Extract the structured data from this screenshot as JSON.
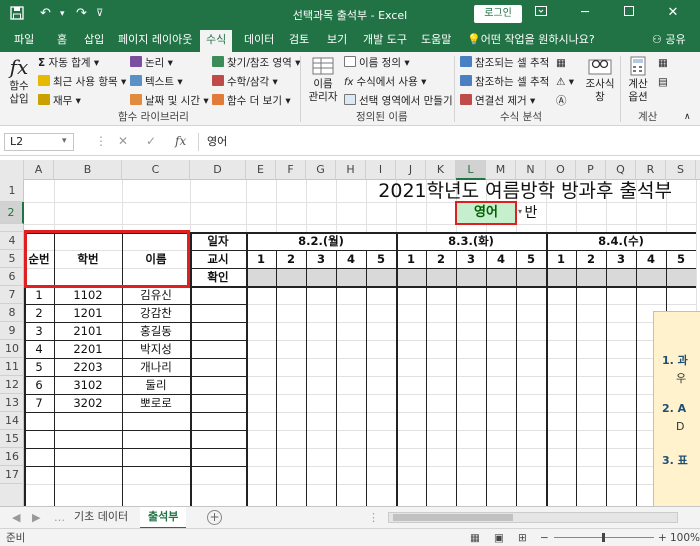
{
  "window": {
    "title": "선택과목 출석부 - Excel",
    "login_label": "로그인"
  },
  "tabs": [
    {
      "label": "파일"
    },
    {
      "label": "홈"
    },
    {
      "label": "삽입"
    },
    {
      "label": "페이지 레이아웃"
    },
    {
      "label": "수식"
    },
    {
      "label": "데이터"
    },
    {
      "label": "검토"
    },
    {
      "label": "보기"
    },
    {
      "label": "개발 도구"
    },
    {
      "label": "도움말"
    }
  ],
  "tell_me": "어떤 작업을 원하시나요?",
  "share": "공유",
  "ribbon": {
    "insert_function": "함수\n삽입",
    "fx_glyph": "fx",
    "lib": {
      "autosum": "자동 합계",
      "recent": "최근 사용 항목",
      "financial": "재무",
      "logical": "논리",
      "text": "텍스트",
      "datetime": "날짜 및 시간",
      "lookup": "찾기/참조 영역",
      "math": "수학/삼각",
      "more": "함수 더 보기"
    },
    "lib_group": "함수 라이브러리",
    "name_manager": "이름\n관리자",
    "names": {
      "define": "이름 정의",
      "use_in_formula": "수식에서 사용",
      "create_from_selection": "선택 영역에서 만들기"
    },
    "names_group": "정의된 이름",
    "audit": {
      "trace_precedents": "참조되는 셀 추적",
      "trace_dependents": "참조하는 셀 추적",
      "remove_arrows": "연결선 제거"
    },
    "watch_window": "조사식\n창",
    "audit_group": "수식 분석",
    "calc_options": "계산\n옵션",
    "calc_group": "계산"
  },
  "formula_bar": {
    "name_box": "L2",
    "cancel_glyph": "✕",
    "enter_glyph": "✓",
    "fx_glyph": "fx",
    "content": "영어"
  },
  "columns": [
    "A",
    "B",
    "C",
    "D",
    "E",
    "F",
    "G",
    "H",
    "I",
    "J",
    "K",
    "L",
    "M",
    "N",
    "O",
    "P",
    "Q",
    "R",
    "S"
  ],
  "rows": [
    "1",
    "2",
    "3",
    "4",
    "5",
    "6",
    "7",
    "8",
    "9",
    "10",
    "11",
    "12",
    "13",
    "14",
    "15",
    "16",
    "17"
  ],
  "sheet": {
    "title": "2021학년도 여름방학 방과후 출석부",
    "subject": "영어",
    "class_suffix": "반",
    "headers": {
      "no": "순번",
      "student_id": "학번",
      "name": "이름"
    },
    "row_labels": {
      "date": "일자",
      "period": "교시",
      "check": "확인"
    },
    "dates": [
      "8.2.(월)",
      "8.3.(화)",
      "8.4.(수)"
    ],
    "periods": [
      "1",
      "2",
      "3",
      "4",
      "5"
    ],
    "students": [
      {
        "no": "1",
        "id": "1102",
        "name": "김유신"
      },
      {
        "no": "2",
        "id": "1201",
        "name": "강감찬"
      },
      {
        "no": "3",
        "id": "2101",
        "name": "홍길동"
      },
      {
        "no": "4",
        "id": "2201",
        "name": "박지성"
      },
      {
        "no": "5",
        "id": "2203",
        "name": "개나리"
      },
      {
        "no": "6",
        "id": "3102",
        "name": "둘리"
      },
      {
        "no": "7",
        "id": "3202",
        "name": "뽀로로"
      }
    ]
  },
  "shape_text": {
    "item1": "1. 과",
    "item1_sub": "우",
    "item2": "2. A",
    "item2_sub": "D",
    "item3": "3. 표"
  },
  "sheet_tabs": [
    "기초 데이터",
    "출석부"
  ],
  "status": {
    "ready": "준비",
    "zoom": "100%"
  },
  "colors": {
    "excel_green": "#217346",
    "selection_green": "#c6efce",
    "outline_red": "#e02020"
  }
}
